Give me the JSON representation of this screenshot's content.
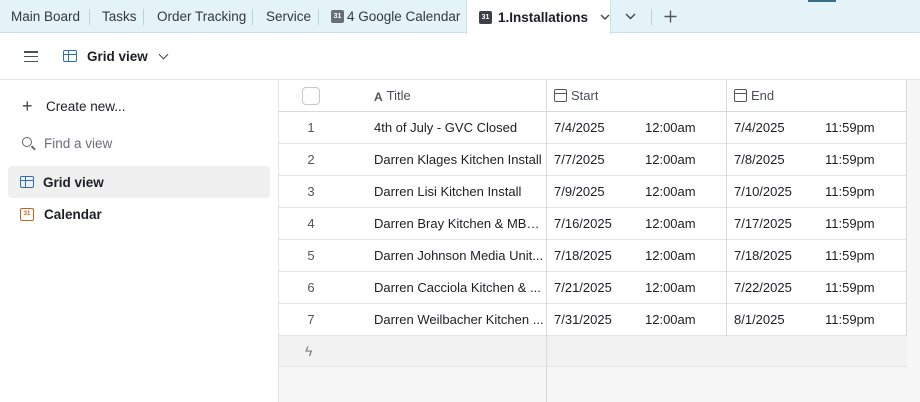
{
  "tabs": [
    {
      "label": "Main Board"
    },
    {
      "label": "Tasks"
    },
    {
      "label": "Order Tracking"
    },
    {
      "label": "Service"
    },
    {
      "label": "4 Google Calendar",
      "icon": "calendar-icon",
      "icon_text": "31"
    },
    {
      "label": "1.Installations",
      "icon": "calendar-icon",
      "icon_text": "31",
      "active": true
    }
  ],
  "toolbar": {
    "view_label": "Grid view"
  },
  "sidebar": {
    "create_label": "Create new...",
    "find_placeholder": "Find a view",
    "views": [
      {
        "label": "Grid view",
        "icon": "grid-icon",
        "active": true
      },
      {
        "label": "Calendar",
        "icon": "calendar-icon",
        "icon_text": "31"
      }
    ]
  },
  "grid": {
    "columns": [
      {
        "label": "Title",
        "icon": "text-field-icon",
        "icon_text": "A"
      },
      {
        "label": "Start",
        "icon": "date-field-icon"
      },
      {
        "label": "End",
        "icon": "date-field-icon"
      }
    ],
    "rows": [
      {
        "num": "1",
        "title": "4th of July - GVC Closed",
        "start_date": "7/4/2025",
        "start_time": "12:00am",
        "end_date": "7/4/2025",
        "end_time": "11:59pm"
      },
      {
        "num": "2",
        "title": "Darren Klages Kitchen Install",
        "start_date": "7/7/2025",
        "start_time": "12:00am",
        "end_date": "7/8/2025",
        "end_time": "11:59pm"
      },
      {
        "num": "3",
        "title": "Darren Lisi Kitchen Install",
        "start_date": "7/9/2025",
        "start_time": "12:00am",
        "end_date": "7/10/2025",
        "end_time": "11:59pm"
      },
      {
        "num": "4",
        "title": "Darren Bray Kitchen & MBa...",
        "start_date": "7/16/2025",
        "start_time": "12:00am",
        "end_date": "7/17/2025",
        "end_time": "11:59pm"
      },
      {
        "num": "5",
        "title": "Darren Johnson Media Unit...",
        "start_date": "7/18/2025",
        "start_time": "12:00am",
        "end_date": "7/18/2025",
        "end_time": "11:59pm"
      },
      {
        "num": "6",
        "title": "Darren Cacciola Kitchen & ...",
        "start_date": "7/21/2025",
        "start_time": "12:00am",
        "end_date": "7/22/2025",
        "end_time": "11:59pm"
      },
      {
        "num": "7",
        "title": "Darren Weilbacher Kitchen ...",
        "start_date": "7/31/2025",
        "start_time": "12:00am",
        "end_date": "8/1/2025",
        "end_time": "11:59pm"
      }
    ]
  },
  "colors": {
    "accent_blue": "#2b6fb5",
    "calendar_orange": "#d1601d",
    "tabbar_bg": "#e4f3f8"
  }
}
